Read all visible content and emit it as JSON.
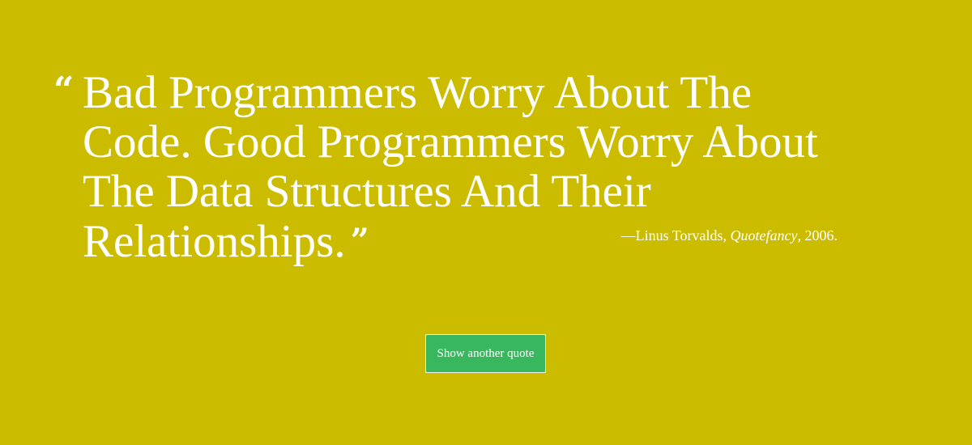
{
  "quote": {
    "open_mark": "“",
    "text": "Bad Programmers Worry About The Code. Good Programmers Worry About The Data Structures And Their Relationships.",
    "close_mark": "”",
    "attribution": {
      "prefix": "—Linus Torvalds, ",
      "source": "Quotefancy",
      "suffix": ", 2006."
    }
  },
  "button": {
    "label": "Show another quote"
  },
  "colors": {
    "background": "#cbbc00",
    "text": "#ffffff",
    "button": "#38b75f"
  }
}
